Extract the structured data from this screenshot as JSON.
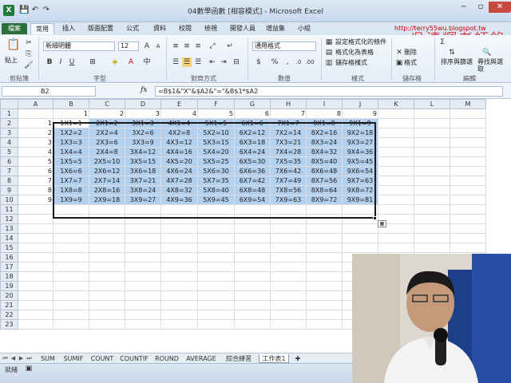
{
  "window": {
    "title": "04數學函數 [相容模式] - Microsoft Excel",
    "minimize": "−",
    "restore": "▫",
    "close": "✕"
  },
  "qat": {
    "save": "💾",
    "undo": "↶",
    "redo": "↷"
  },
  "tabs": [
    {
      "label": "檔案"
    },
    {
      "label": "常用"
    },
    {
      "label": "插入"
    },
    {
      "label": "版面配置"
    },
    {
      "label": "公式"
    },
    {
      "label": "資料"
    },
    {
      "label": "校閱"
    },
    {
      "label": "檢視"
    },
    {
      "label": "開發人員"
    },
    {
      "label": "增益集"
    },
    {
      "label": "小組"
    }
  ],
  "overlay": {
    "url": "http://terry55wu.blogspot.tw",
    "signature": "吳清輝老師錄製"
  },
  "ribbon": {
    "paste": "貼上",
    "font_name": "新細明體",
    "font_size": "12",
    "number_format": "通用格式",
    "conditional_format": "設定格式化的條件",
    "format_as_table": "格式化為表格",
    "cell_styles": "儲存格樣式",
    "insert": "插入",
    "delete": "刪除",
    "format": "格式",
    "sort_filter": "排序與篩選",
    "find_select": "尋找與選取",
    "groups": {
      "clipboard": "剪貼簿",
      "font": "字型",
      "alignment": "對齊方式",
      "number": "數值",
      "styles": "樣式",
      "cells": "儲存格",
      "editing": "編輯"
    }
  },
  "formula_bar": {
    "name_box": "B2",
    "fx": "fx",
    "formula": "=B$1&\"X\"&$A2&\"=\"&B$1*$A2"
  },
  "grid": {
    "columns": [
      "A",
      "B",
      "C",
      "D",
      "E",
      "F",
      "G",
      "H",
      "I",
      "J",
      "K",
      "L",
      "M"
    ],
    "row_headers": [
      "1",
      "2",
      "3",
      "4",
      "5",
      "6",
      "7",
      "8",
      "9",
      "10",
      "11",
      "12",
      "13",
      "14",
      "15",
      "16",
      "17",
      "18",
      "19",
      "20",
      "21",
      "22",
      "23"
    ],
    "header_row": [
      "1",
      "2",
      "3",
      "4",
      "5",
      "6",
      "7",
      "8",
      "9"
    ],
    "row_labels": [
      "1",
      "2",
      "3",
      "4",
      "5",
      "6",
      "7",
      "8",
      "9"
    ],
    "table": [
      [
        "1X1=1",
        "2X1=2",
        "3X1=3",
        "4X1=4",
        "5X1=5",
        "6X1=6",
        "7X1=7",
        "8X1=8",
        "9X1=9"
      ],
      [
        "1X2=2",
        "2X2=4",
        "3X2=6",
        "4X2=8",
        "5X2=10",
        "6X2=12",
        "7X2=14",
        "8X2=16",
        "9X2=18"
      ],
      [
        "1X3=3",
        "2X3=6",
        "3X3=9",
        "4X3=12",
        "5X3=15",
        "6X3=18",
        "7X3=21",
        "8X3=24",
        "9X3=27"
      ],
      [
        "1X4=4",
        "2X4=8",
        "3X4=12",
        "4X4=16",
        "5X4=20",
        "6X4=24",
        "7X4=28",
        "8X4=32",
        "9X4=36"
      ],
      [
        "1X5=5",
        "2X5=10",
        "3X5=15",
        "4X5=20",
        "5X5=25",
        "6X5=30",
        "7X5=35",
        "8X5=40",
        "9X5=45"
      ],
      [
        "1X6=6",
        "2X6=12",
        "3X6=18",
        "4X6=24",
        "5X6=30",
        "6X6=36",
        "7X6=42",
        "8X6=48",
        "9X6=54"
      ],
      [
        "1X7=7",
        "2X7=14",
        "3X7=21",
        "4X7=28",
        "5X7=35",
        "6X7=42",
        "7X7=49",
        "8X7=56",
        "9X7=63"
      ],
      [
        "1X8=8",
        "2X8=16",
        "3X8=24",
        "4X8=32",
        "5X8=40",
        "6X8=48",
        "7X8=56",
        "8X8=64",
        "9X8=72"
      ],
      [
        "1X9=9",
        "2X9=18",
        "3X9=27",
        "4X9=36",
        "5X9=45",
        "6X9=54",
        "7X9=63",
        "8X9=72",
        "9X9=81"
      ]
    ]
  },
  "sheet_tabs": [
    "SUM",
    "SUMIF",
    "COUNT",
    "COUNTIF",
    "ROUND",
    "AVERAGE",
    "綜合練習",
    "工作表1"
  ],
  "active_sheet": "工作表1",
  "status": {
    "ready": "就緒"
  }
}
